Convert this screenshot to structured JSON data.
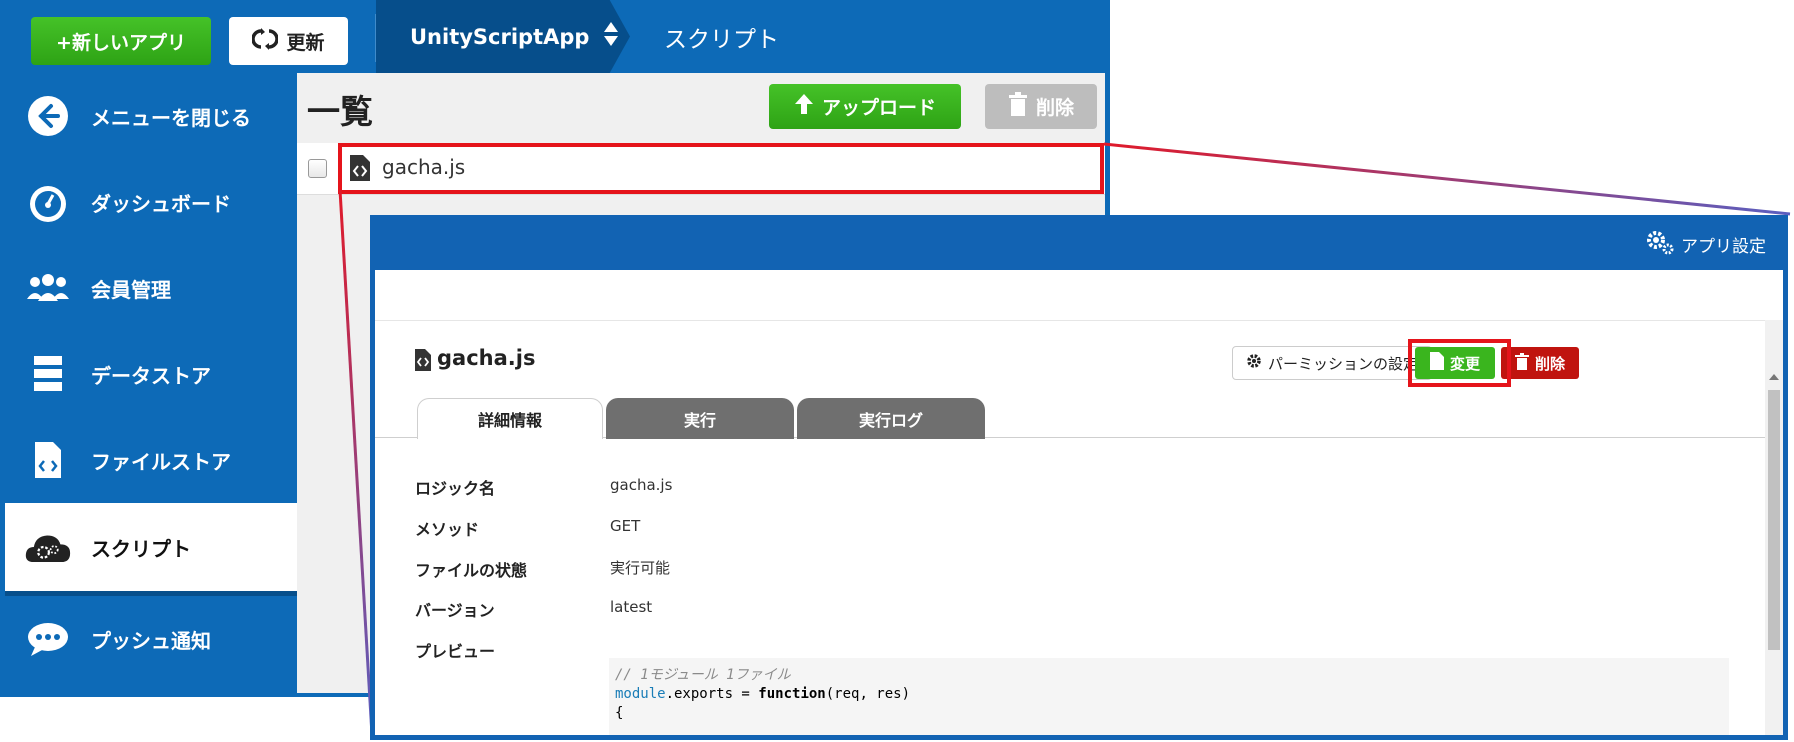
{
  "topbar": {
    "new_app_label": "+新しいアプリ",
    "refresh_label": "更新",
    "app_name": "UnityScriptApp",
    "page_name": "スクリプト"
  },
  "sidebar": {
    "items": [
      {
        "label": "メニューを閉じる",
        "icon": "arrow-left-circle-icon"
      },
      {
        "label": "ダッシュボード",
        "icon": "gauge-icon"
      },
      {
        "label": "会員管理",
        "icon": "users-icon"
      },
      {
        "label": "データストア",
        "icon": "database-icon"
      },
      {
        "label": "ファイルストア",
        "icon": "file-code-icon"
      },
      {
        "label": "スクリプト",
        "icon": "cloud-gears-icon",
        "active": true
      },
      {
        "label": "プッシュ通知",
        "icon": "chat-bubble-icon"
      }
    ]
  },
  "list": {
    "title": "一覧",
    "upload_label": "アップロード",
    "delete_label": "削除",
    "rows": [
      {
        "file_name": "gacha.js"
      }
    ]
  },
  "detail": {
    "app_settings_label": "アプリ設定",
    "file_name": "gacha.js",
    "permission_label": "パーミッションの設定",
    "edit_label": "変更",
    "delete_label": "削除",
    "tabs": [
      "詳細情報",
      "実行",
      "実行ログ"
    ],
    "fields": [
      {
        "label": "ロジック名",
        "value": "gacha.js"
      },
      {
        "label": "メソッド",
        "value": "GET"
      },
      {
        "label": "ファイルの状態",
        "value": "実行可能"
      },
      {
        "label": "バージョン",
        "value": "latest"
      },
      {
        "label": "プレビュー",
        "value": ""
      }
    ],
    "code": {
      "line1": "// 1モジュール 1ファイル",
      "line2_obj": "module",
      "line2_mid": ".exports = ",
      "line2_kw": "function",
      "line2_end": "(req, res)",
      "line3": "{"
    }
  },
  "colors": {
    "brand_blue": "#0d6ab7",
    "green": "#3ab51e",
    "danger_red": "#c0140f",
    "highlight_red": "#e5141b"
  }
}
